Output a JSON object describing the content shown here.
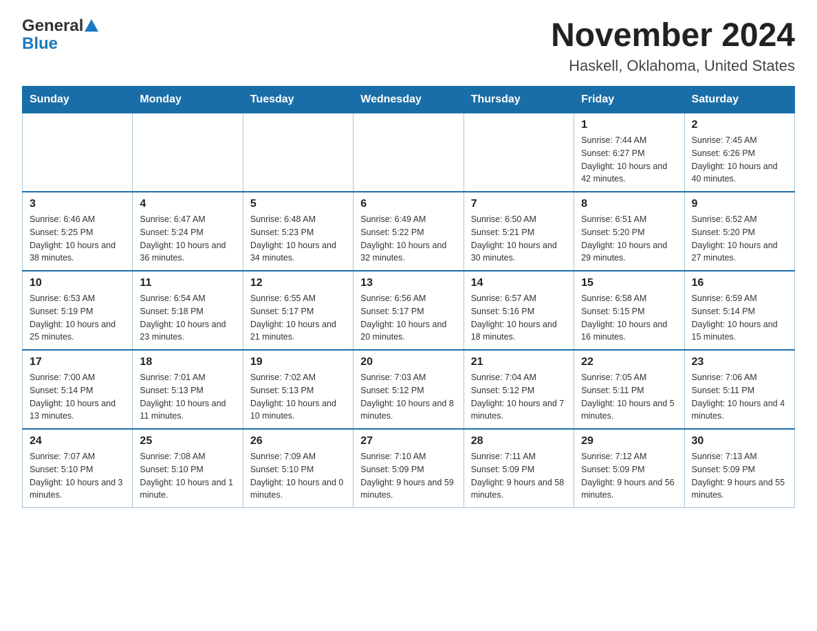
{
  "logo": {
    "general": "General",
    "blue": "Blue"
  },
  "header": {
    "title": "November 2024",
    "subtitle": "Haskell, Oklahoma, United States"
  },
  "days_of_week": [
    "Sunday",
    "Monday",
    "Tuesday",
    "Wednesday",
    "Thursday",
    "Friday",
    "Saturday"
  ],
  "weeks": [
    [
      {
        "day": "",
        "sunrise": "",
        "sunset": "",
        "daylight": ""
      },
      {
        "day": "",
        "sunrise": "",
        "sunset": "",
        "daylight": ""
      },
      {
        "day": "",
        "sunrise": "",
        "sunset": "",
        "daylight": ""
      },
      {
        "day": "",
        "sunrise": "",
        "sunset": "",
        "daylight": ""
      },
      {
        "day": "",
        "sunrise": "",
        "sunset": "",
        "daylight": ""
      },
      {
        "day": "1",
        "sunrise": "Sunrise: 7:44 AM",
        "sunset": "Sunset: 6:27 PM",
        "daylight": "Daylight: 10 hours and 42 minutes."
      },
      {
        "day": "2",
        "sunrise": "Sunrise: 7:45 AM",
        "sunset": "Sunset: 6:26 PM",
        "daylight": "Daylight: 10 hours and 40 minutes."
      }
    ],
    [
      {
        "day": "3",
        "sunrise": "Sunrise: 6:46 AM",
        "sunset": "Sunset: 5:25 PM",
        "daylight": "Daylight: 10 hours and 38 minutes."
      },
      {
        "day": "4",
        "sunrise": "Sunrise: 6:47 AM",
        "sunset": "Sunset: 5:24 PM",
        "daylight": "Daylight: 10 hours and 36 minutes."
      },
      {
        "day": "5",
        "sunrise": "Sunrise: 6:48 AM",
        "sunset": "Sunset: 5:23 PM",
        "daylight": "Daylight: 10 hours and 34 minutes."
      },
      {
        "day": "6",
        "sunrise": "Sunrise: 6:49 AM",
        "sunset": "Sunset: 5:22 PM",
        "daylight": "Daylight: 10 hours and 32 minutes."
      },
      {
        "day": "7",
        "sunrise": "Sunrise: 6:50 AM",
        "sunset": "Sunset: 5:21 PM",
        "daylight": "Daylight: 10 hours and 30 minutes."
      },
      {
        "day": "8",
        "sunrise": "Sunrise: 6:51 AM",
        "sunset": "Sunset: 5:20 PM",
        "daylight": "Daylight: 10 hours and 29 minutes."
      },
      {
        "day": "9",
        "sunrise": "Sunrise: 6:52 AM",
        "sunset": "Sunset: 5:20 PM",
        "daylight": "Daylight: 10 hours and 27 minutes."
      }
    ],
    [
      {
        "day": "10",
        "sunrise": "Sunrise: 6:53 AM",
        "sunset": "Sunset: 5:19 PM",
        "daylight": "Daylight: 10 hours and 25 minutes."
      },
      {
        "day": "11",
        "sunrise": "Sunrise: 6:54 AM",
        "sunset": "Sunset: 5:18 PM",
        "daylight": "Daylight: 10 hours and 23 minutes."
      },
      {
        "day": "12",
        "sunrise": "Sunrise: 6:55 AM",
        "sunset": "Sunset: 5:17 PM",
        "daylight": "Daylight: 10 hours and 21 minutes."
      },
      {
        "day": "13",
        "sunrise": "Sunrise: 6:56 AM",
        "sunset": "Sunset: 5:17 PM",
        "daylight": "Daylight: 10 hours and 20 minutes."
      },
      {
        "day": "14",
        "sunrise": "Sunrise: 6:57 AM",
        "sunset": "Sunset: 5:16 PM",
        "daylight": "Daylight: 10 hours and 18 minutes."
      },
      {
        "day": "15",
        "sunrise": "Sunrise: 6:58 AM",
        "sunset": "Sunset: 5:15 PM",
        "daylight": "Daylight: 10 hours and 16 minutes."
      },
      {
        "day": "16",
        "sunrise": "Sunrise: 6:59 AM",
        "sunset": "Sunset: 5:14 PM",
        "daylight": "Daylight: 10 hours and 15 minutes."
      }
    ],
    [
      {
        "day": "17",
        "sunrise": "Sunrise: 7:00 AM",
        "sunset": "Sunset: 5:14 PM",
        "daylight": "Daylight: 10 hours and 13 minutes."
      },
      {
        "day": "18",
        "sunrise": "Sunrise: 7:01 AM",
        "sunset": "Sunset: 5:13 PM",
        "daylight": "Daylight: 10 hours and 11 minutes."
      },
      {
        "day": "19",
        "sunrise": "Sunrise: 7:02 AM",
        "sunset": "Sunset: 5:13 PM",
        "daylight": "Daylight: 10 hours and 10 minutes."
      },
      {
        "day": "20",
        "sunrise": "Sunrise: 7:03 AM",
        "sunset": "Sunset: 5:12 PM",
        "daylight": "Daylight: 10 hours and 8 minutes."
      },
      {
        "day": "21",
        "sunrise": "Sunrise: 7:04 AM",
        "sunset": "Sunset: 5:12 PM",
        "daylight": "Daylight: 10 hours and 7 minutes."
      },
      {
        "day": "22",
        "sunrise": "Sunrise: 7:05 AM",
        "sunset": "Sunset: 5:11 PM",
        "daylight": "Daylight: 10 hours and 5 minutes."
      },
      {
        "day": "23",
        "sunrise": "Sunrise: 7:06 AM",
        "sunset": "Sunset: 5:11 PM",
        "daylight": "Daylight: 10 hours and 4 minutes."
      }
    ],
    [
      {
        "day": "24",
        "sunrise": "Sunrise: 7:07 AM",
        "sunset": "Sunset: 5:10 PM",
        "daylight": "Daylight: 10 hours and 3 minutes."
      },
      {
        "day": "25",
        "sunrise": "Sunrise: 7:08 AM",
        "sunset": "Sunset: 5:10 PM",
        "daylight": "Daylight: 10 hours and 1 minute."
      },
      {
        "day": "26",
        "sunrise": "Sunrise: 7:09 AM",
        "sunset": "Sunset: 5:10 PM",
        "daylight": "Daylight: 10 hours and 0 minutes."
      },
      {
        "day": "27",
        "sunrise": "Sunrise: 7:10 AM",
        "sunset": "Sunset: 5:09 PM",
        "daylight": "Daylight: 9 hours and 59 minutes."
      },
      {
        "day": "28",
        "sunrise": "Sunrise: 7:11 AM",
        "sunset": "Sunset: 5:09 PM",
        "daylight": "Daylight: 9 hours and 58 minutes."
      },
      {
        "day": "29",
        "sunrise": "Sunrise: 7:12 AM",
        "sunset": "Sunset: 5:09 PM",
        "daylight": "Daylight: 9 hours and 56 minutes."
      },
      {
        "day": "30",
        "sunrise": "Sunrise: 7:13 AM",
        "sunset": "Sunset: 5:09 PM",
        "daylight": "Daylight: 9 hours and 55 minutes."
      }
    ]
  ]
}
